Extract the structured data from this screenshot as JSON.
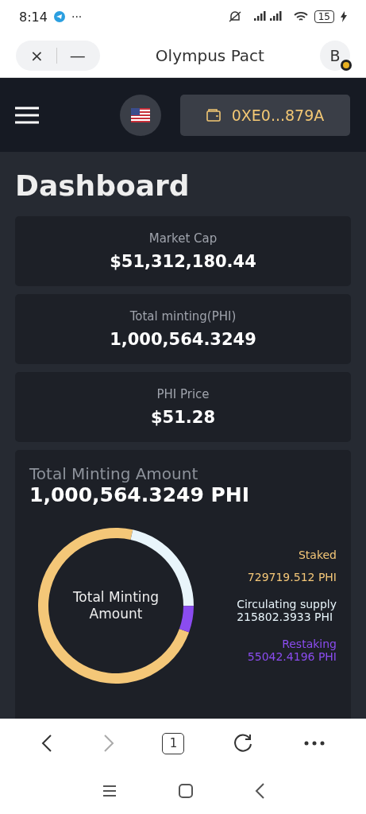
{
  "status_bar": {
    "time": "8:14",
    "more": "···",
    "battery": "15"
  },
  "browser_header": {
    "title": "Olympus Pact",
    "close": "×",
    "minimize": "—",
    "profile_letter": "B"
  },
  "app_nav": {
    "wallet_address": "0XE0...879A"
  },
  "page_title": "Dashboard",
  "stats": [
    {
      "label": "Market Cap",
      "value": "$51,312,180.44"
    },
    {
      "label": "Total minting(PHI)",
      "value": "1,000,564.3249"
    },
    {
      "label": "PHI Price",
      "value": "$51.28"
    }
  ],
  "minting_card": {
    "title": "Total Minting Amount",
    "total": "1,000,564.3249 PHI",
    "chart_data": {
      "type": "donut",
      "categories": [
        "Staked",
        "Circulating supply",
        "Restaking"
      ],
      "series": [
        {
          "name": "Total Minting Amount",
          "values": [
            72.93,
            21.57,
            5.5
          ]
        }
      ],
      "value_labels": [
        "729719.512 PHI",
        "215802.3933 PHI",
        "55042.4196 PHI"
      ],
      "colors": [
        "#f4c778",
        "#e9f5fb",
        "#8b4cf0"
      ]
    }
  },
  "browser_toolbar": {
    "tab_count": "1"
  }
}
